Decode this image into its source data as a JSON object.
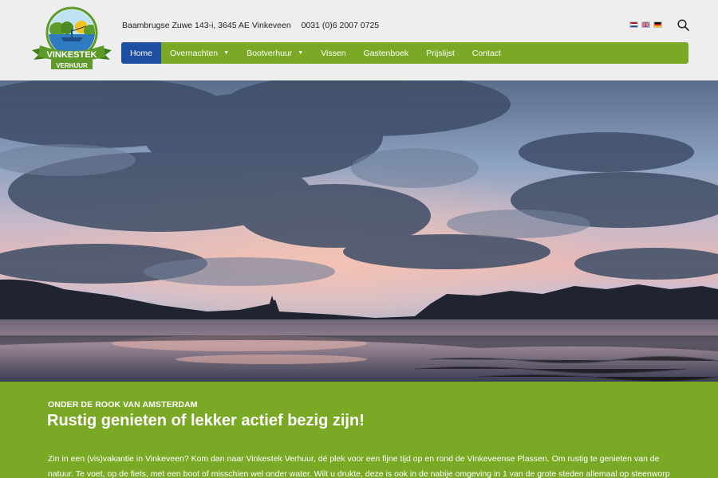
{
  "logo": {
    "line1": "VINKESTEK",
    "line2": "VERHUUR",
    "alt": "Vinkestek Verhuur logo"
  },
  "header": {
    "address": "Baambrugse Zuwe 143-i, 3645 AE Vinkeveen",
    "phone": "0031 (0)6 2007 0725",
    "languages": [
      "nl-flag-icon",
      "en-flag-icon",
      "de-flag-icon"
    ],
    "search_icon": "search-icon"
  },
  "nav": {
    "items": [
      {
        "label": "Home",
        "active": true
      },
      {
        "label": "Overnachten",
        "dropdown": true
      },
      {
        "label": "Bootverhuur",
        "dropdown": true
      },
      {
        "label": "Vissen"
      },
      {
        "label": "Gastenboek"
      },
      {
        "label": "Prijslijst"
      },
      {
        "label": "Contact"
      }
    ],
    "dropdown_icon": "chevron-down-icon"
  },
  "colors": {
    "brand_green": "#7aaa25",
    "active_blue": "#1f4fa3",
    "header_bg": "#eeeeee"
  },
  "intro": {
    "kicker": "ONDER DE ROOK VAN AMSTERDAM",
    "title": "Rustig genieten of lekker actief bezig zijn!",
    "text": "Zin in een (vis)vakantie in Vinkeveen? Kom dan naar Vinkestek Verhuur, dé plek voor een fijne tijd op en rond de Vinkeveense Plassen. Om rustig te genieten van de natuur. Te voet, op de fiets, met een boot of misschien wel onder water. Wilt u drukte, deze is ook in de nabije omgeving in 1 van de grote steden allemaal op steenworp"
  }
}
